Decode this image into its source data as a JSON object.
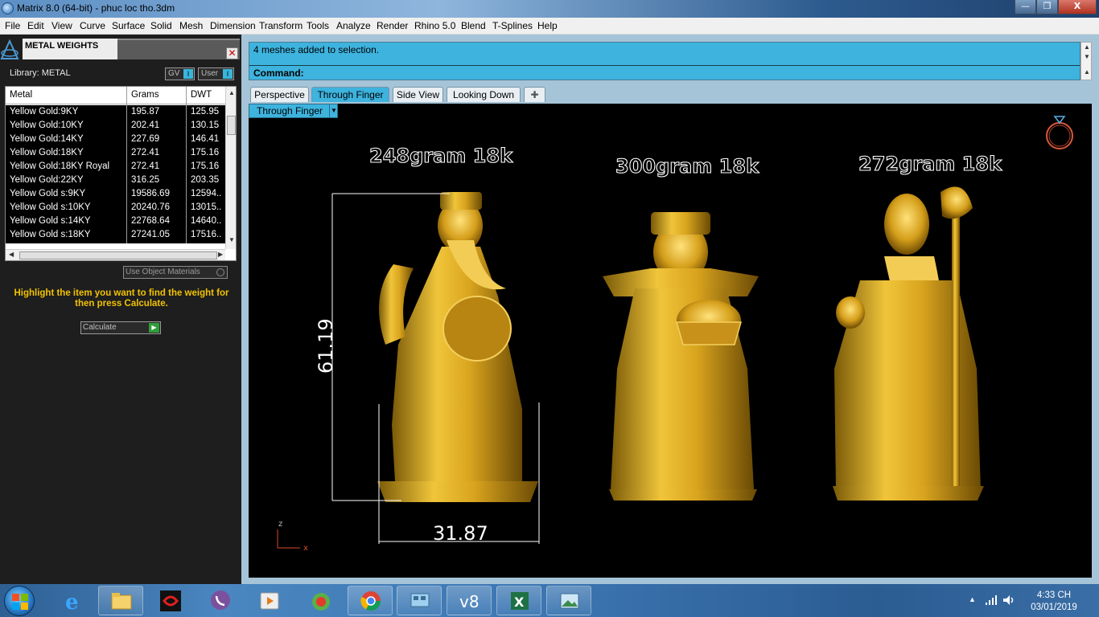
{
  "window": {
    "title": "Matrix 8.0 (64-bit) - phuc loc tho.3dm",
    "min_label": "—",
    "max_label": "❐",
    "close_label": "X"
  },
  "menu": [
    "File",
    "Edit",
    "View",
    "Curve",
    "Surface",
    "Solid",
    "Mesh",
    "Dimension",
    "Transform",
    "Tools",
    "Analyze",
    "Render",
    "Rhino 5.0",
    "Blend",
    "T-Splines",
    "Help"
  ],
  "panel": {
    "title": "METAL WEIGHTS",
    "close_label": "✕",
    "library_label": "Library: METAL",
    "gv_label": "GV",
    "gv_indicator": "I",
    "user_label": "User",
    "user_indicator": "I",
    "table": {
      "headers": [
        "Metal",
        "Grams",
        "DWT"
      ],
      "rows": [
        [
          "Yellow Gold:9KY",
          "195.87",
          "125.95"
        ],
        [
          "Yellow Gold:10KY",
          "202.41",
          "130.15"
        ],
        [
          "Yellow Gold:14KY",
          "227.69",
          "146.41"
        ],
        [
          "Yellow Gold:18KY",
          "272.41",
          "175.16"
        ],
        [
          "Yellow Gold:18KY Royal",
          "272.41",
          "175.16"
        ],
        [
          "Yellow Gold:22KY",
          "316.25",
          "203.35"
        ],
        [
          "Yellow Gold s:9KY",
          "19586.69",
          "12594.."
        ],
        [
          "Yellow Gold s:10KY",
          "20240.76",
          "13015.."
        ],
        [
          "Yellow Gold s:14KY",
          "22768.64",
          "14640.."
        ],
        [
          "Yellow Gold s:18KY",
          "27241.05",
          "17516.."
        ]
      ]
    },
    "use_object_materials": "Use Object Materials",
    "hint": "Highlight the item you want to find the weight for then press Calculate.",
    "calculate_label": "Calculate"
  },
  "command": {
    "history": "4 meshes added to selection.",
    "prompt": "Command:"
  },
  "viewport_tabs": [
    "Perspective",
    "Through Finger",
    "Side View",
    "Looking Down"
  ],
  "active_tab": "Through Finger",
  "viewport": {
    "name": "Through Finger",
    "labels": [
      "248gram 18k",
      "300gram 18k",
      "272gram 18k"
    ],
    "dim_height": "61.19",
    "dim_width": "31.87",
    "axis_z": "z",
    "axis_x": "x"
  },
  "taskbar": {
    "time": "4:33 CH",
    "date": "03/01/2019",
    "apps": [
      "internet-explorer-icon",
      "file-explorer-icon",
      "garena-icon",
      "viber-icon",
      "media-player-icon",
      "matrix-gem-icon",
      "chrome-icon",
      "control-panel-icon",
      "v8-icon",
      "excel-icon",
      "photo-viewer-icon"
    ]
  },
  "colors": {
    "accent_blue": "#3db3de",
    "gold": "#d4a520",
    "hint_yellow": "#f2c200",
    "panel_bg": "#1e1e1e"
  }
}
